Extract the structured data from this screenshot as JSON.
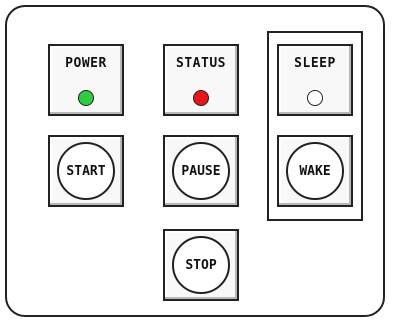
{
  "indicators": [
    {
      "id": "power",
      "label": "POWER",
      "led_color": "#2ecc40"
    },
    {
      "id": "status",
      "label": "STATUS",
      "led_color": "#e8151b"
    },
    {
      "id": "sleep",
      "label": "SLEEP",
      "led_color": "#ffffff"
    }
  ],
  "buttons": [
    {
      "id": "start",
      "label": "START"
    },
    {
      "id": "pause",
      "label": "PAUSE"
    },
    {
      "id": "wake",
      "label": "WAKE"
    },
    {
      "id": "stop",
      "label": "STOP"
    }
  ]
}
